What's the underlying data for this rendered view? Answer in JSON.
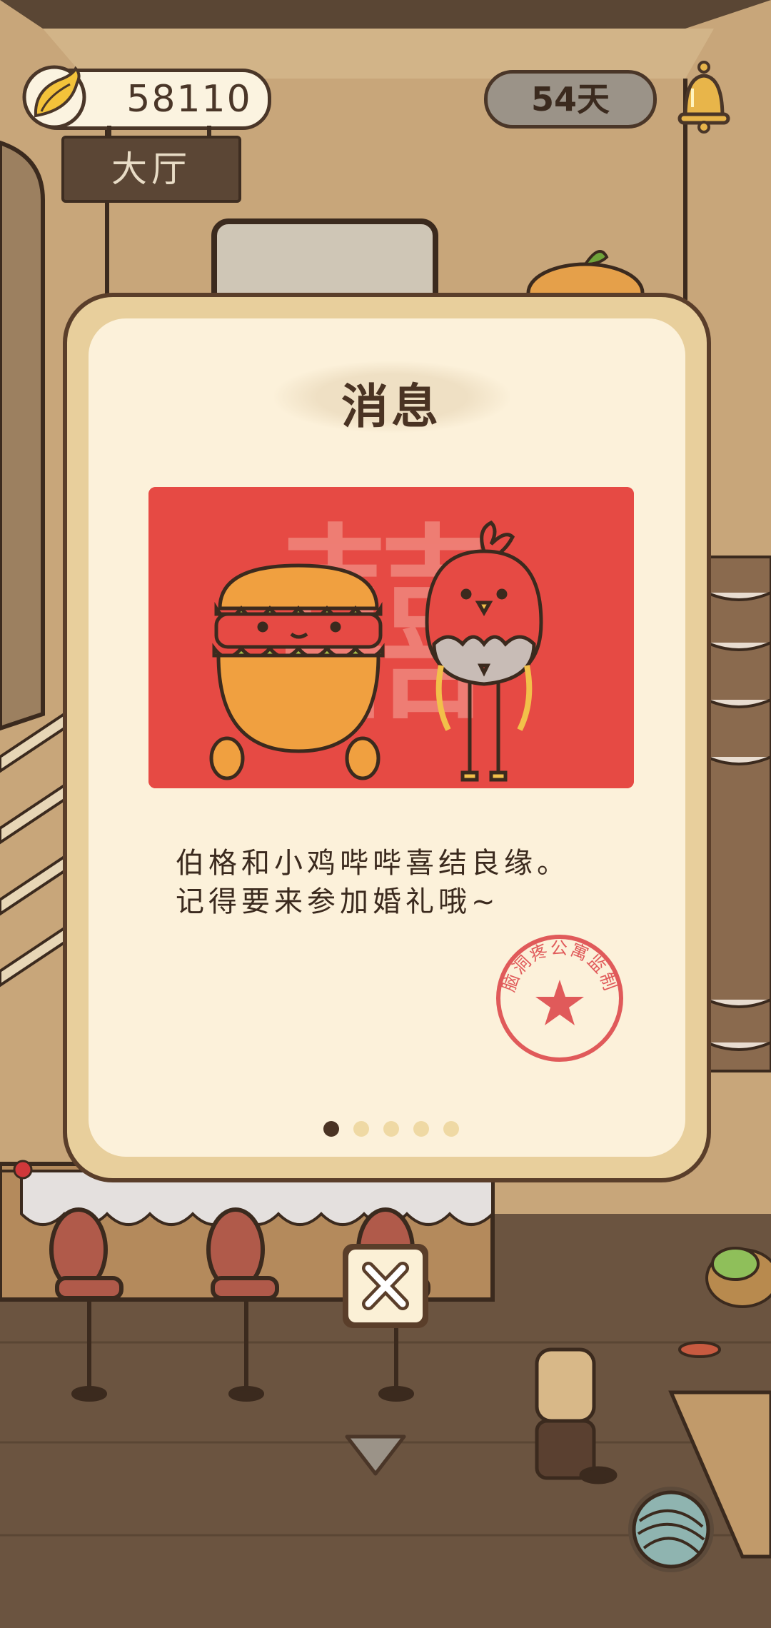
{
  "hud": {
    "coins": "58110",
    "days": "54天",
    "room_name": "大厅"
  },
  "dialog": {
    "title": "消息",
    "message_lines": [
      "伯格和小鸡哔哔喜结良缘。",
      "记得要来参加婚礼哦~"
    ],
    "stamp_text": "脑洞疼公寓监制",
    "card_character": "囍",
    "page_count": 5,
    "active_page": 1
  },
  "colors": {
    "card_red": "#e64a44",
    "dialog_bg": "#fcf1da",
    "dialog_border": "#e8cf9c",
    "text_dark": "#4a3323",
    "stamp_red": "#e05a5a"
  },
  "icons": {
    "currency": "banana-icon",
    "notifications": "bell-icon",
    "close": "close-icon",
    "collapse": "chevron-down-icon",
    "yarn": "yarn-ball-icon"
  }
}
